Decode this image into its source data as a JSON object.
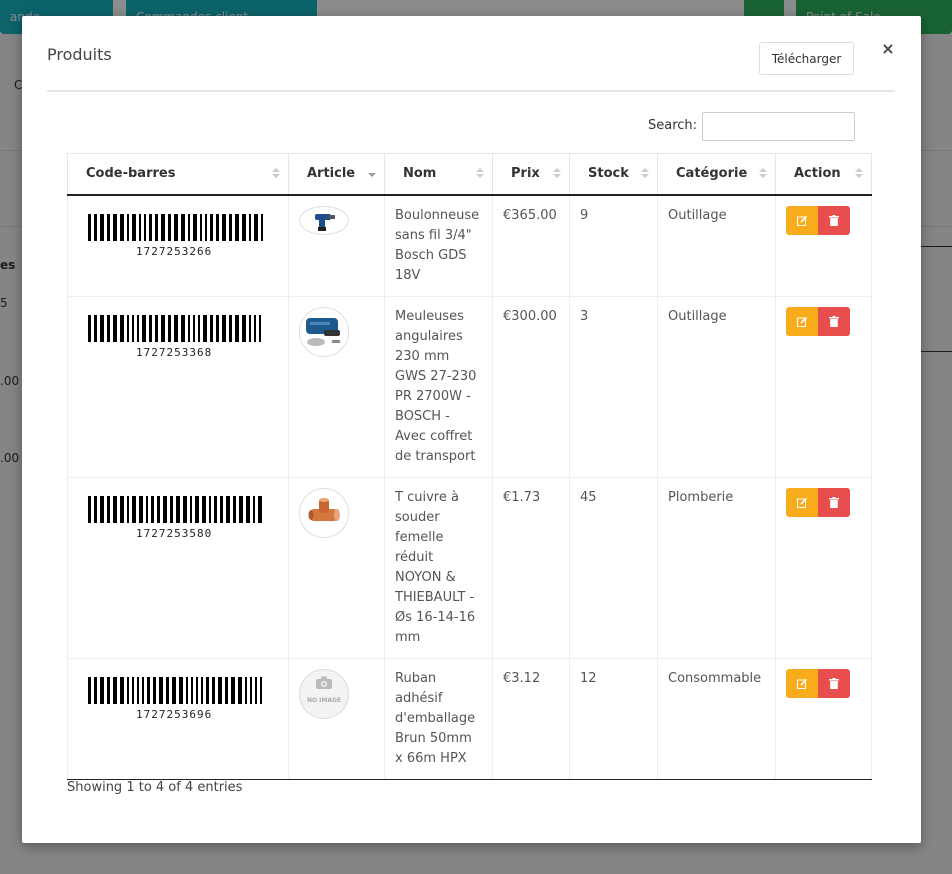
{
  "background": {
    "buttons": [
      "ande ",
      "Commandes client",
      "",
      "Point of Sale"
    ],
    "side_text": [
      "C",
      "es",
      "5",
      ".00",
      ".00"
    ]
  },
  "modal": {
    "title": "Produits",
    "download_label": "Télécharger",
    "close_symbol": "×",
    "search_label": "Search:",
    "search_value": "",
    "info": "Showing 1 to 4 of 4 entries"
  },
  "table": {
    "columns": [
      "Code-barres",
      "Article",
      "Nom",
      "Prix",
      "Stock",
      "Catégorie",
      "Action"
    ],
    "rows": [
      {
        "barcode": "1727253266",
        "image": "drill-image",
        "name": "Boulonneuse sans fil 3/4\" Bosch GDS 18V",
        "price": "€365.00",
        "stock": "9",
        "category": "Outillage"
      },
      {
        "barcode": "1727253368",
        "image": "grinder-image",
        "name": "Meuleuses angulaires 230 mm GWS 27-230 PR 2700W - BOSCH - Avec coffret de transport",
        "price": "€300.00",
        "stock": "3",
        "category": "Outillage"
      },
      {
        "barcode": "1727253580",
        "image": "copper-tee-image",
        "name": "T cuivre à souder femelle réduit NOYON & THIEBAULT - Øs 16-14-16 mm",
        "price": "€1.73",
        "stock": "45",
        "category": "Plomberie"
      },
      {
        "barcode": "1727253696",
        "image": "no-image-placeholder",
        "name": "Ruban adhésif d'emballage Brun 50mm x 66m HPX",
        "price": "€3.12",
        "stock": "12",
        "category": "Consommable"
      }
    ],
    "no_image_label": "NO IMAGE"
  },
  "colors": {
    "edit": "#f8ac1c",
    "delete": "#e84e4e",
    "teal": "#16b4c4",
    "green": "#2fb55d"
  }
}
